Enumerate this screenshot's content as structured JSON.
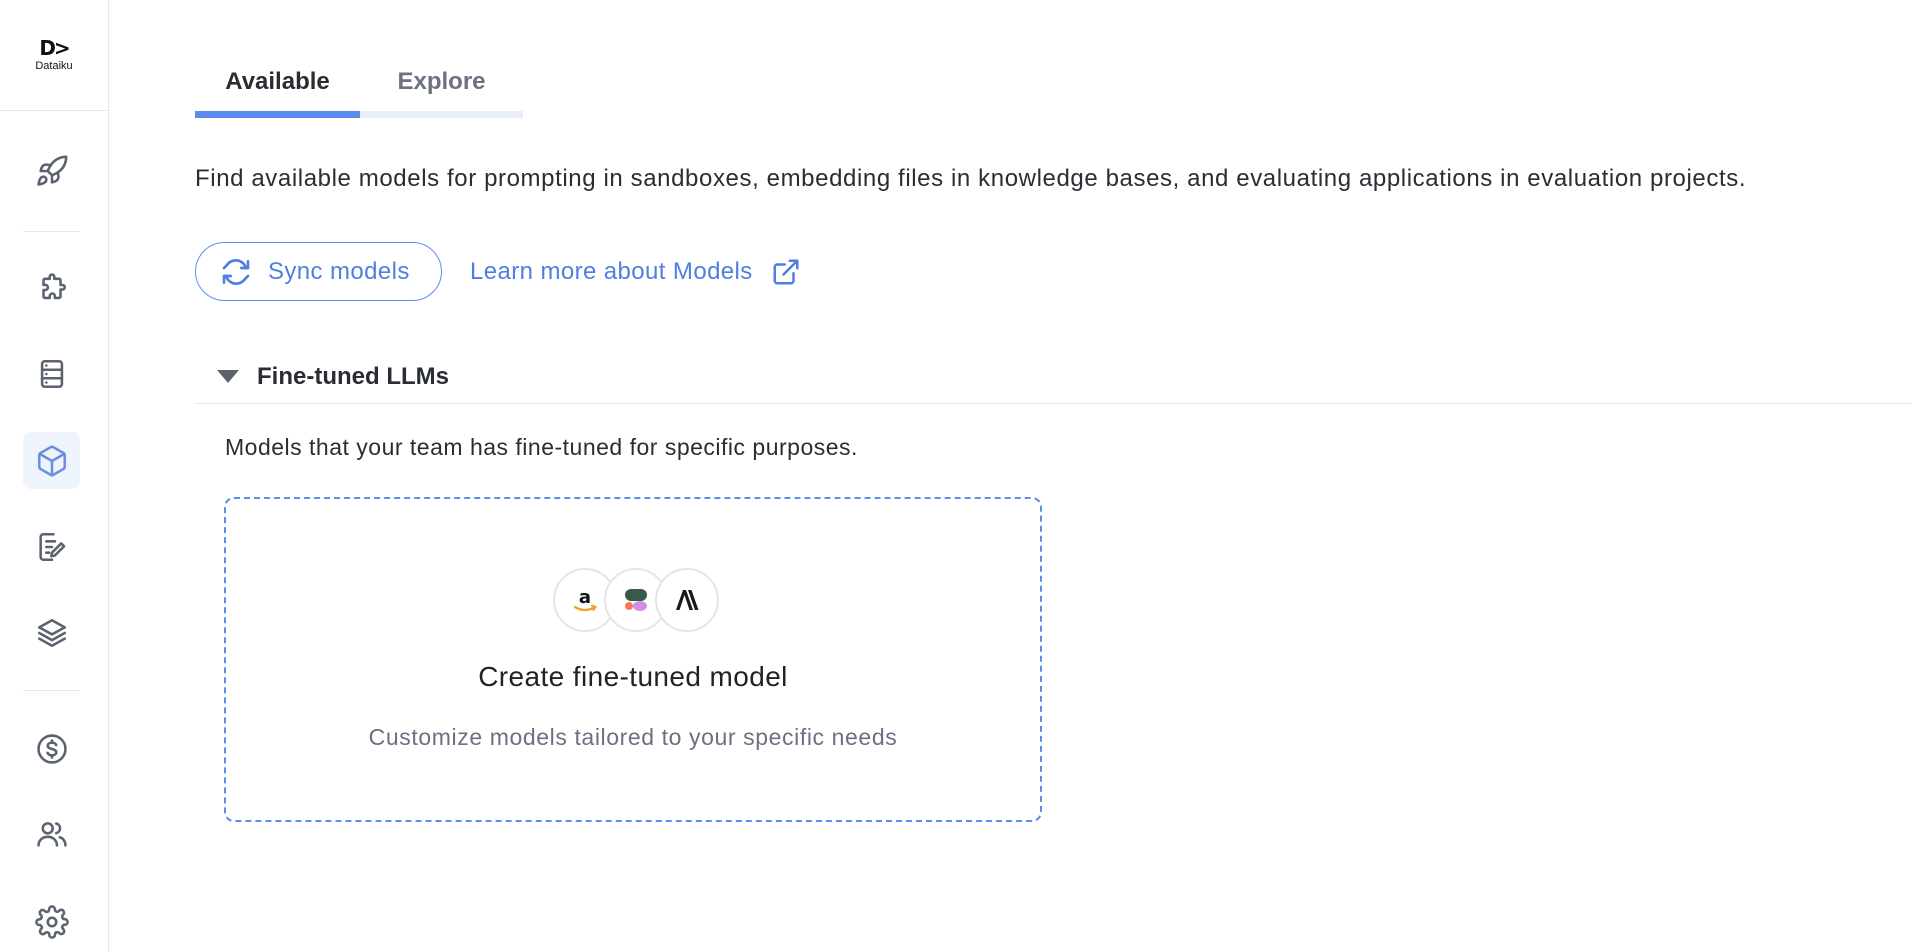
{
  "app": {
    "logo_text": "Dataiku",
    "logo_mark": "D>"
  },
  "sidebar": {
    "items": [
      {
        "icon": "rocket-icon"
      },
      {
        "icon": "puzzle-icon"
      },
      {
        "icon": "server-icon"
      },
      {
        "icon": "cube-icon",
        "active": true
      },
      {
        "icon": "edit-document-icon"
      },
      {
        "icon": "layers-icon"
      },
      {
        "icon": "dollar-icon"
      },
      {
        "icon": "users-icon"
      },
      {
        "icon": "gear-icon"
      }
    ]
  },
  "tabs": [
    {
      "label": "Available",
      "active": true
    },
    {
      "label": "Explore",
      "active": false
    }
  ],
  "main": {
    "description": "Find available models for prompting in sandboxes, embedding files in knowledge bases, and evaluating applications in evaluation projects.",
    "sync_button_label": "Sync models",
    "learn_more_label": "Learn more about Models"
  },
  "section": {
    "title": "Fine-tuned LLMs",
    "description": "Models that your team has fine-tuned for specific purposes.",
    "card": {
      "title": "Create fine-tuned model",
      "subtitle": "Customize models tailored to your specific needs",
      "providers": [
        "amazon-logo",
        "cohere-logo",
        "anthropic-logo"
      ]
    }
  },
  "colors": {
    "accent": "#5b8def",
    "active_bg": "#eef3fc",
    "text": "#2a2d33",
    "muted": "#6b7180"
  }
}
